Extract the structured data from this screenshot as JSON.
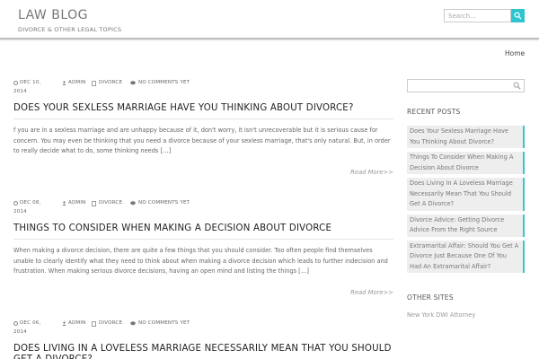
{
  "header": {
    "site_title": "LAW BLOG",
    "tagline": "DIVORCE & OTHER LEGAL TOPICS",
    "search_placeholder": "Search...",
    "accent_color": "#2cc4cf"
  },
  "nav": {
    "home": "Home"
  },
  "posts": [
    {
      "date_line1": "DEC 10,",
      "date_line2": "2014",
      "author": "ADMIN",
      "category": "DIVORCE",
      "comments": "NO COMMENTS YET",
      "title": "DOES YOUR SEXLESS MARRIAGE HAVE YOU THINKING ABOUT DIVORCE?",
      "excerpt": "f you are in a sexless marriage and are unhappy because of it, don't worry, it isn't unrecoverable but it is serious cause for concern. You may even be thinking that you need a divorce because of your sexless marriage, that's only natural. But, in order to really decide what to do, some thinking needs […]",
      "read_more": "Read More>>"
    },
    {
      "date_line1": "DEC 08,",
      "date_line2": "2014",
      "author": "ADMIN",
      "category": "DIVORCE",
      "comments": "NO COMMENTS YET",
      "title": "THINGS TO CONSIDER WHEN MAKING A DECISION ABOUT DIVORCE",
      "excerpt": "When making a divorce decision, there are quite a few things that you should consider. Too often people find themselves unable to clearly identify what they need to think about when making a divorce decision which leads to further indecision and frustration. When making serious divorce decisions, having an open mind and listing the things […]",
      "read_more": "Read More>>"
    },
    {
      "date_line1": "DEC 06,",
      "date_line2": "2014",
      "author": "ADMIN",
      "category": "DIVORCE",
      "comments": "NO COMMENTS YET",
      "title": "DOES LIVING IN A LOVELESS MARRIAGE NECESSARILY MEAN THAT YOU SHOULD GET A DIVORCE?"
    }
  ],
  "sidebar": {
    "recent_posts_title": "RECENT POSTS",
    "recent_posts": [
      "Does Your Sexless Marriage Have You Thinking About Divorce?",
      "Things To Consider When Making A Decision About Divorce",
      "Does Living In A Loveless Marriage Necessarily Mean That You Should Get A Divorce?",
      "Divorce Advice: Getting Divorce Advice From the Right Source",
      "Extramarital Affair: Should You Get A Divorce Just Because One Of You Had An Extramarital Affair?"
    ],
    "other_sites_title": "OTHER SITES",
    "other_sites": [
      "New York DWI Attorney"
    ]
  }
}
